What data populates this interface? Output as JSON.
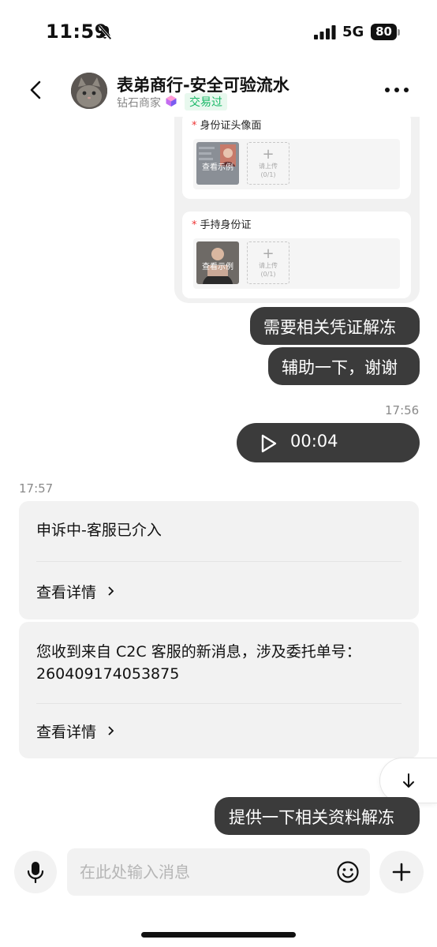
{
  "status_bar": {
    "time": "11:59",
    "network": "5G",
    "battery": "80"
  },
  "header": {
    "title": "表弟商行-安全可验流水",
    "subtitle": "钻石商家",
    "badge": "交易过"
  },
  "form_card": {
    "fields": [
      {
        "required_mark": "*",
        "label": "身份证头像面",
        "sample_label": "查看示例",
        "upload_label": "请上传",
        "upload_count": "(0/1)"
      },
      {
        "required_mark": "*",
        "label": "手持身份证",
        "sample_label": "查看示例",
        "upload_label": "请上传",
        "upload_count": "(0/1)"
      }
    ]
  },
  "messages": {
    "out1": "需要相关凭证解冻",
    "out2": "辅助一下，谢谢",
    "ts1": "17:56",
    "voice_duration": "00:04",
    "ts2": "17:57",
    "sys1_text": "申诉中-客服已介入",
    "sys1_link": "查看详情",
    "sys2_text_line1": "您收到来自 C2C 客服的新消息，涉及委托单号：",
    "sys2_text_line2": "260409174053875",
    "sys2_link": "查看详情",
    "out3": "提供一下相关资料解冻"
  },
  "input_bar": {
    "placeholder": "在此处输入消息"
  },
  "colors": {
    "bubble_dark": "#3b3b3b",
    "badge_green": "#18b866",
    "required_red": "#e33333"
  }
}
